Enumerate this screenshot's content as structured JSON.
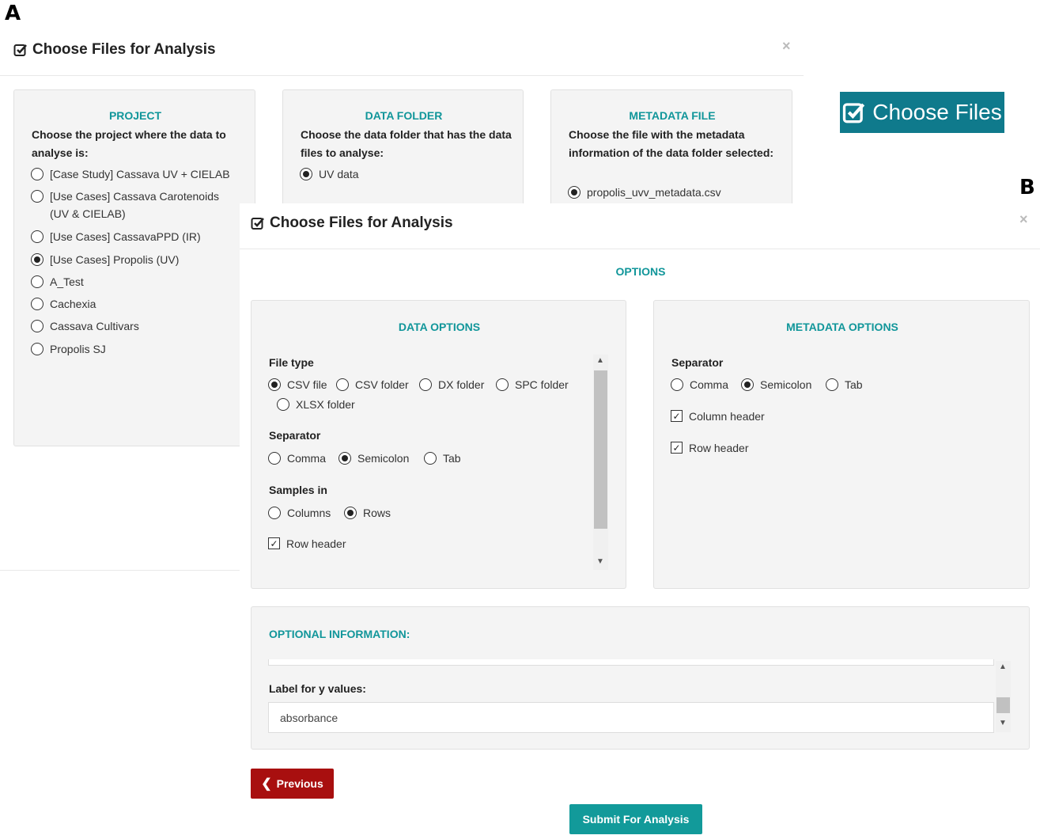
{
  "labels": {
    "a": "A",
    "b": "B"
  },
  "panel_a": {
    "title": "Choose Files for Analysis",
    "close": "×",
    "project": {
      "heading": "PROJECT",
      "description": "Choose the project where the data to analyse is:",
      "options": [
        {
          "label": "[Case Study] Cassava UV + CIELAB",
          "selected": false
        },
        {
          "label": "[Use Cases] Cassava Carotenoids (UV & CIELAB)",
          "selected": false
        },
        {
          "label": "[Use Cases] CassavaPPD (IR)",
          "selected": false
        },
        {
          "label": "[Use Cases] Propolis (UV)",
          "selected": true
        },
        {
          "label": "A_Test",
          "selected": false
        },
        {
          "label": "Cachexia",
          "selected": false
        },
        {
          "label": "Cassava Cultivars",
          "selected": false
        },
        {
          "label": "Propolis SJ",
          "selected": false
        }
      ]
    },
    "data_folder": {
      "heading": "DATA FOLDER",
      "description": "Choose the data folder that has the data files to analyse:",
      "options": [
        {
          "label": "UV data",
          "selected": true
        }
      ]
    },
    "metadata_file": {
      "heading": "METADATA FILE",
      "description": "Choose the file with the metadata information of the data folder selected:",
      "options": [
        {
          "label": "propolis_uvv_metadata.csv",
          "selected": true
        }
      ]
    },
    "choose_files_button": "Choose Files"
  },
  "panel_b": {
    "title": "Choose Files for Analysis",
    "close": "×",
    "options_heading": "OPTIONS",
    "data_options": {
      "heading": "DATA OPTIONS",
      "file_type_label": "File type",
      "file_types": [
        {
          "label": "CSV file",
          "selected": true
        },
        {
          "label": "CSV folder",
          "selected": false
        },
        {
          "label": "DX folder",
          "selected": false
        },
        {
          "label": "SPC folder",
          "selected": false
        },
        {
          "label": "XLSX folder",
          "selected": false
        }
      ],
      "separator_label": "Separator",
      "separators": [
        {
          "label": "Comma",
          "selected": false
        },
        {
          "label": "Semicolon",
          "selected": true
        },
        {
          "label": "Tab",
          "selected": false
        }
      ],
      "samples_in_label": "Samples in",
      "samples_in": [
        {
          "label": "Columns",
          "selected": false
        },
        {
          "label": "Rows",
          "selected": true
        }
      ],
      "row_header": {
        "label": "Row header",
        "checked": true
      }
    },
    "metadata_options": {
      "heading": "METADATA OPTIONS",
      "separator_label": "Separator",
      "separators": [
        {
          "label": "Comma",
          "selected": false
        },
        {
          "label": "Semicolon",
          "selected": true
        },
        {
          "label": "Tab",
          "selected": false
        }
      ],
      "column_header": {
        "label": "Column header",
        "checked": true
      },
      "row_header": {
        "label": "Row header",
        "checked": true
      }
    },
    "optional_info": {
      "heading": "OPTIONAL INFORMATION:",
      "y_label": "Label for y values:",
      "y_value": "absorbance"
    },
    "previous_button": "Previous",
    "submit_button": "Submit For Analysis"
  },
  "colors": {
    "teal": "#11969a",
    "choose_button": "#0f7a8c",
    "previous": "#a80f0f",
    "submit": "#129a9a"
  },
  "icons": {
    "title": "check-square-icon",
    "previous": "chevron-left-icon"
  }
}
